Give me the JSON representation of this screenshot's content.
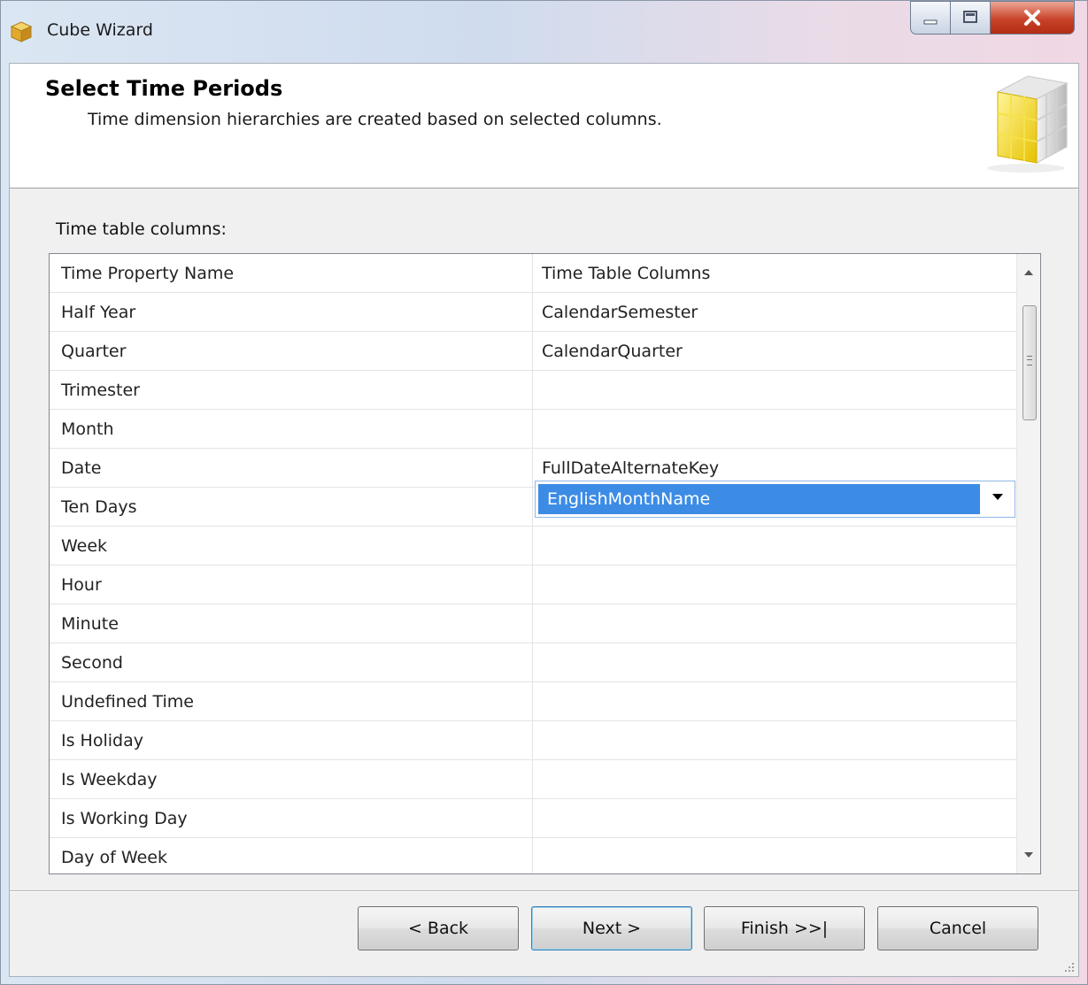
{
  "window": {
    "title": "Cube Wizard",
    "icon": "cube-icon",
    "controls": [
      "minimize-icon",
      "maximize-icon",
      "close-icon"
    ]
  },
  "header": {
    "title": "Select Time Periods",
    "subtitle": "Time dimension hierarchies are created based on selected columns.",
    "graphic": "cube-graphic"
  },
  "grid": {
    "label": "Time table columns:",
    "columns": [
      "Time Property Name",
      "Time Table Columns"
    ],
    "rows": [
      {
        "property": "Half Year",
        "column": "CalendarSemester"
      },
      {
        "property": "Quarter",
        "column": "CalendarQuarter"
      },
      {
        "property": "Trimester",
        "column": ""
      },
      {
        "property": "Month",
        "column": "EnglishMonthName",
        "selected": true
      },
      {
        "property": "Date",
        "column": "FullDateAlternateKey"
      },
      {
        "property": "Ten Days",
        "column": ""
      },
      {
        "property": "Week",
        "column": ""
      },
      {
        "property": "Hour",
        "column": ""
      },
      {
        "property": "Minute",
        "column": ""
      },
      {
        "property": "Second",
        "column": ""
      },
      {
        "property": "Undefined Time",
        "column": ""
      },
      {
        "property": "Is Holiday",
        "column": ""
      },
      {
        "property": "Is Weekday",
        "column": ""
      },
      {
        "property": "Is Working Day",
        "column": ""
      },
      {
        "property": "Day of Week",
        "column": ""
      }
    ],
    "selection_color": "#3c8ce6"
  },
  "buttons": {
    "back": "< Back",
    "next": "Next >",
    "finish": "Finish >>|",
    "cancel": "Cancel"
  }
}
